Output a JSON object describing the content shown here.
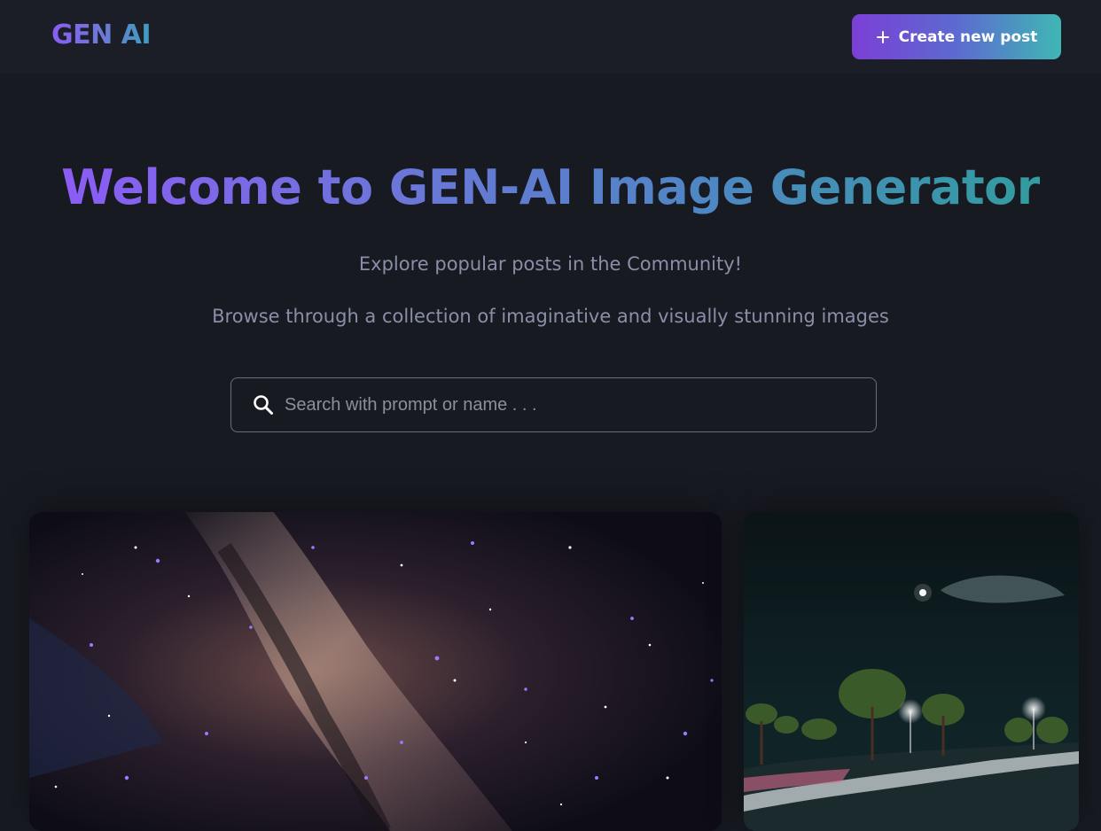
{
  "navbar": {
    "logo": "GEN AI",
    "create_button_label": "Create new post"
  },
  "hero": {
    "title": "Welcome to GEN-AI Image Generator",
    "subtitle_1": "Explore popular posts in the Community!",
    "subtitle_2": "Browse through a collection of imaginative and visually stunning images"
  },
  "search": {
    "placeholder": "Search with prompt or name . . .",
    "value": ""
  },
  "gallery": {
    "cards": [
      {
        "scene": "milky-way-starry-sky"
      },
      {
        "scene": "night-street-with-moon-and-lamps"
      }
    ]
  },
  "colors": {
    "background": "#181a22",
    "navbar": "#1c1e27",
    "gradient_start": "#7b3fd6",
    "gradient_end": "#3fb7b4",
    "text_muted": "#8a8fa8"
  },
  "icons": {
    "create": "plus-icon",
    "search": "search-icon"
  }
}
